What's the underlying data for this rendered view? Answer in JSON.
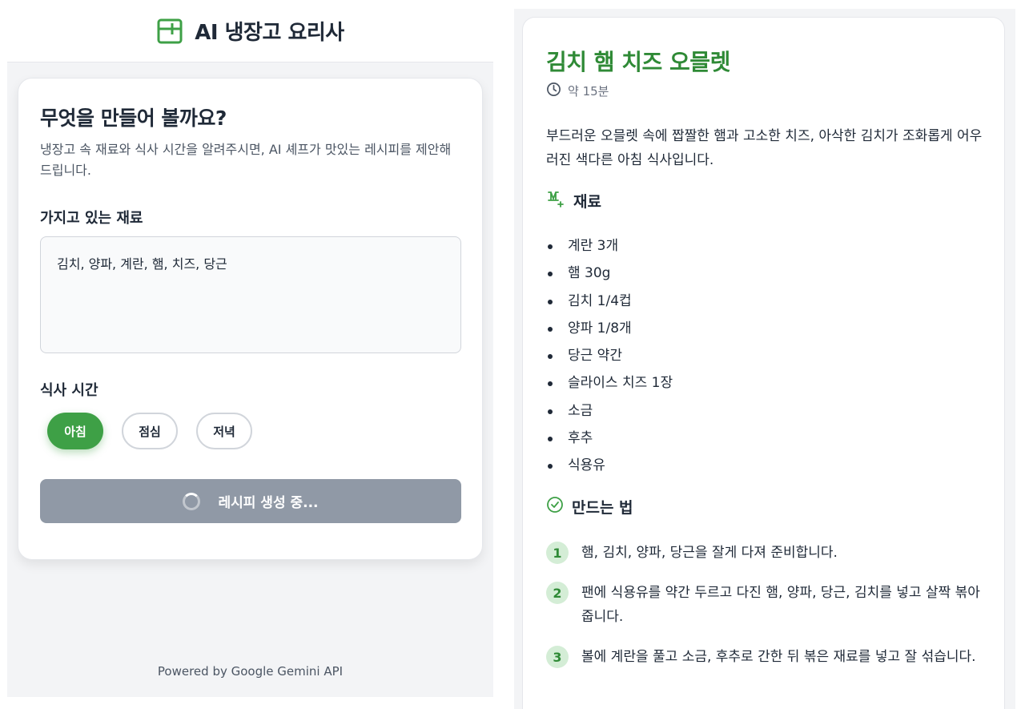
{
  "app": {
    "title": "AI 냉장고 요리사",
    "accent": "#3ea046"
  },
  "form": {
    "heading": "무엇을 만들어 볼까요?",
    "description": "냉장고 속 재료와 식사 시간을 알려주시면, AI 셰프가 맛있는 레시피를 제안해 드립니다.",
    "ingredients_label": "가지고 있는 재료",
    "ingredients_value": "김치, 양파, 계란, 햄, 치즈, 당근",
    "meal_time_label": "식사 시간",
    "meal_options": [
      "아침",
      "점심",
      "저녁"
    ],
    "selected_meal": "아침",
    "generate_button": "레시피 생성 중..."
  },
  "footer": "Powered by Google Gemini API",
  "recipe": {
    "title": "김치 햄 치즈 오믈렛",
    "time": "약 15분",
    "description": "부드러운 오믈렛 속에 짭짤한 햄과 고소한 치즈, 아삭한 김치가 조화롭게 어우러진 색다른 아침 식사입니다.",
    "ingredients_heading": "재료",
    "ingredients": [
      "계란 3개",
      "햄 30g",
      "김치 1/4컵",
      "양파 1/8개",
      "당근 약간",
      "슬라이스 치즈 1장",
      "소금",
      "후추",
      "식용유"
    ],
    "steps_heading": "만드는 법",
    "steps": [
      {
        "num": "1",
        "text": "햄, 김치, 양파, 당근을 잘게 다져 준비합니다."
      },
      {
        "num": "2",
        "text": "팬에 식용유를 약간 두르고 다진 햄, 양파, 당근, 김치를 넣고 살짝 볶아줍니다."
      },
      {
        "num": "3",
        "text": "볼에 계란을 풀고 소금, 후추로 간한 뒤 볶은 재료를 넣고 잘 섞습니다."
      }
    ]
  }
}
